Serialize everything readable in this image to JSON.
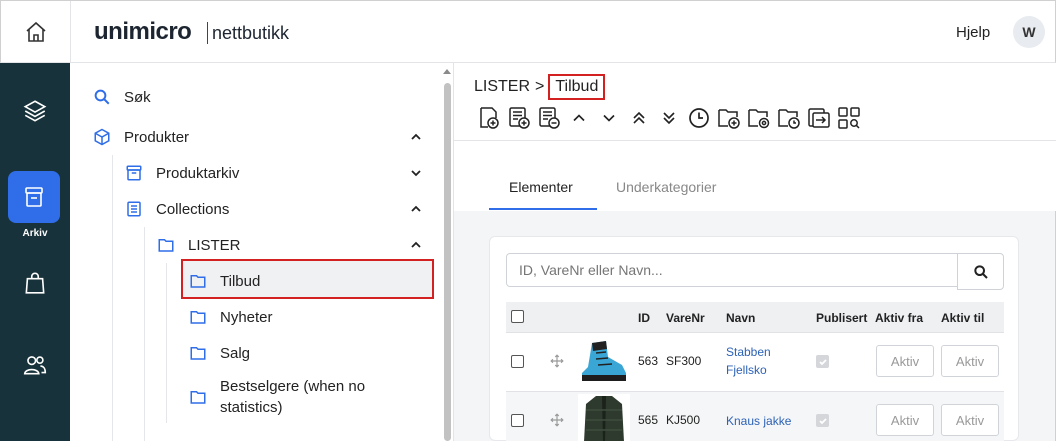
{
  "header": {
    "logo_main": "unimicro",
    "logo_sub": "nettbutikk",
    "help": "Hjelp",
    "user_initial": "W"
  },
  "rail": {
    "active_label": "Arkiv",
    "icons": [
      "layers-icon",
      "archive-box-icon",
      "shopping-bag-icon",
      "users-icon"
    ]
  },
  "tree": {
    "items": [
      {
        "label": "Søk"
      },
      {
        "label": "Produkter"
      },
      {
        "label": "Produktarkiv"
      },
      {
        "label": "Collections"
      },
      {
        "label": "LISTER"
      },
      {
        "label": "Tilbud"
      },
      {
        "label": "Nyheter"
      },
      {
        "label": "Salg"
      },
      {
        "label": "Bestselgere (when no"
      },
      {
        "label": "statistics)"
      }
    ]
  },
  "breadcrumb": {
    "parent": "LISTER",
    "separator": ">",
    "current": "Tilbud"
  },
  "tabs": {
    "active": "Elementer",
    "other": "Underkategorier"
  },
  "search": {
    "placeholder": "ID, VareNr eller Navn..."
  },
  "grid": {
    "headers": {
      "id": "ID",
      "varenr": "VareNr",
      "navn": "Navn",
      "publisert": "Publisert",
      "aktiv_fra": "Aktiv fra",
      "aktiv_til": "Aktiv til"
    },
    "rows": [
      {
        "id": "563",
        "varenr": "SF300",
        "navn1": "Stabben",
        "navn2": "Fjellsko",
        "aktiv_fra": "Aktiv",
        "aktiv_til": "Aktiv"
      },
      {
        "id": "565",
        "varenr": "KJ500",
        "navn1": "Knaus jakke",
        "navn2": "",
        "aktiv_fra": "Aktiv",
        "aktiv_til": "Aktiv"
      }
    ]
  },
  "colors": {
    "accent": "#2f6ee8",
    "rail_bg": "#17323a",
    "highlight": "#d32020",
    "link": "#2d62b5"
  }
}
